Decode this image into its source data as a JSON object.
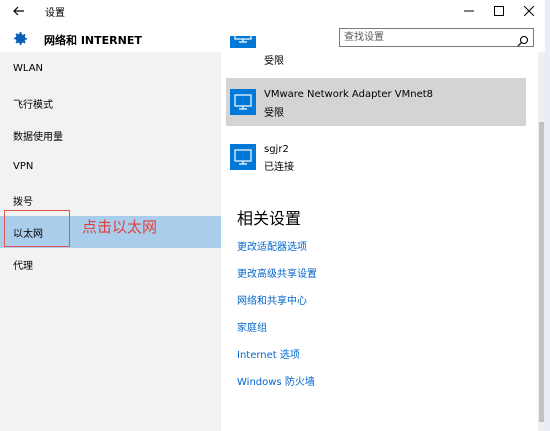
{
  "window": {
    "title": "设置",
    "back_icon": "back-arrow-icon",
    "controls": [
      "minimize-icon",
      "maximize-icon",
      "close-icon"
    ]
  },
  "header": {
    "section_title": "网络和 INTERNET",
    "search_placeholder": "查找设置",
    "icon": "gear-icon"
  },
  "sidebar": {
    "items": [
      {
        "label": "WLAN"
      },
      {
        "label": "飞行模式"
      },
      {
        "label": "数据使用量"
      },
      {
        "label": "VPN"
      },
      {
        "label": "拨号"
      },
      {
        "label": "以太网",
        "active": true
      },
      {
        "label": "代理"
      }
    ],
    "annotation": "点击以太网",
    "colors": {
      "active": "#a9cdeb",
      "annotation": "#e04040"
    }
  },
  "networks": [
    {
      "name": "",
      "status": "受限"
    },
    {
      "name": "VMware Network Adapter VMnet8",
      "status": "受限",
      "highlighted": true
    },
    {
      "name": "sgjr2",
      "status": "已连接"
    }
  ],
  "related": {
    "heading": "相关设置",
    "links": [
      "更改适配器选项",
      "更改高级共享设置",
      "网络和共享中心",
      "家庭组",
      "Internet 选项",
      "Windows 防火墙"
    ]
  },
  "colors": {
    "accent": "#0078d7",
    "link": "#0066cc"
  }
}
